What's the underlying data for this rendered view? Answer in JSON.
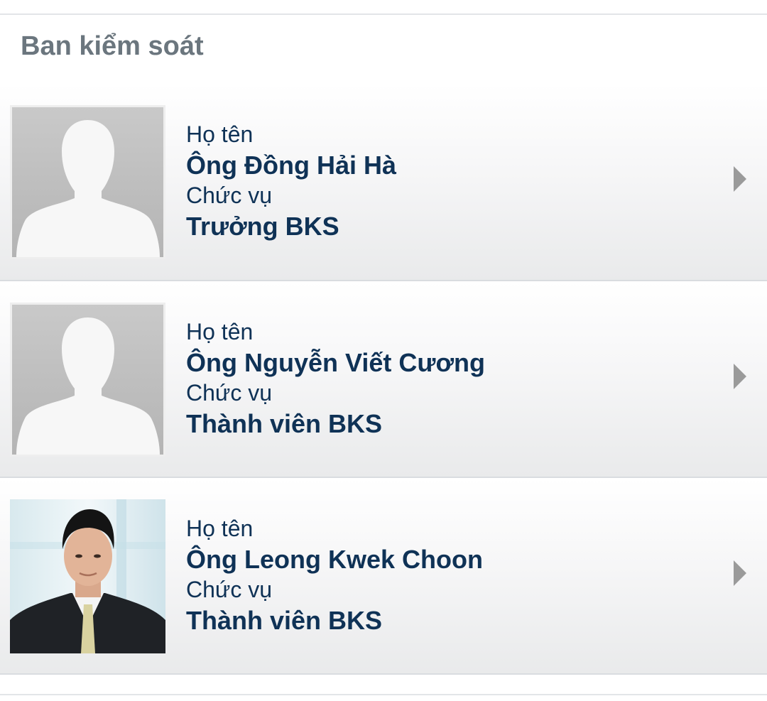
{
  "section": {
    "title": "Ban kiểm soát"
  },
  "members": [
    {
      "name_label": "Họ tên",
      "name": "Ông Đồng Hải Hà",
      "role_label": "Chức vụ",
      "role": "Trưởng BKS",
      "avatar": "placeholder-avatar-icon"
    },
    {
      "name_label": "Họ tên",
      "name": "Ông Nguyễn Viết Cương",
      "role_label": "Chức vụ",
      "role": "Thành viên BKS",
      "avatar": "placeholder-avatar-icon"
    },
    {
      "name_label": "Họ tên",
      "name": "Ông Leong Kwek Choon",
      "role_label": "Chức vụ",
      "role": "Thành viên BKS",
      "avatar": "member-photo"
    }
  ],
  "colors": {
    "title": "#6b767e",
    "text": "#0f3256",
    "chevron": "#9a9a9a",
    "divider": "#d9dce0"
  }
}
